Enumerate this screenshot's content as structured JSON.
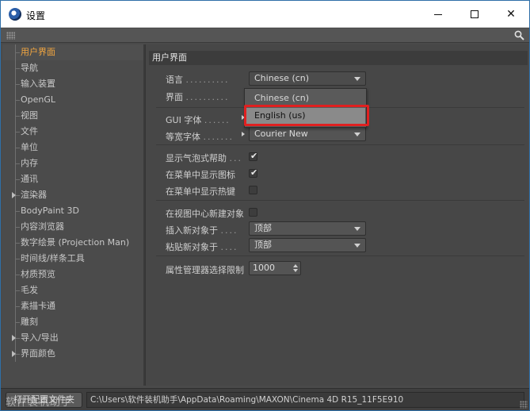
{
  "window": {
    "title": "设置"
  },
  "sidebar": {
    "items": [
      {
        "label": "用户界面",
        "active": true,
        "expandable": false
      },
      {
        "label": "导航",
        "active": false,
        "expandable": false
      },
      {
        "label": "输入装置",
        "active": false,
        "expandable": false
      },
      {
        "label": "OpenGL",
        "active": false,
        "expandable": false
      },
      {
        "label": "视图",
        "active": false,
        "expandable": false
      },
      {
        "label": "文件",
        "active": false,
        "expandable": false
      },
      {
        "label": "单位",
        "active": false,
        "expandable": false
      },
      {
        "label": "内存",
        "active": false,
        "expandable": false
      },
      {
        "label": "通讯",
        "active": false,
        "expandable": false
      },
      {
        "label": "渲染器",
        "active": false,
        "expandable": true
      },
      {
        "label": "BodyPaint 3D",
        "active": false,
        "expandable": false
      },
      {
        "label": "内容浏览器",
        "active": false,
        "expandable": false
      },
      {
        "label": "数字绘景 (Projection Man)",
        "active": false,
        "expandable": false
      },
      {
        "label": "时间线/样条工具",
        "active": false,
        "expandable": false
      },
      {
        "label": "材质预览",
        "active": false,
        "expandable": false
      },
      {
        "label": "毛发",
        "active": false,
        "expandable": false
      },
      {
        "label": "素描卡通",
        "active": false,
        "expandable": false
      },
      {
        "label": "雕刻",
        "active": false,
        "expandable": false
      },
      {
        "label": "导入/导出",
        "active": false,
        "expandable": true
      },
      {
        "label": "界面颜色",
        "active": false,
        "expandable": true
      }
    ],
    "accent_color": "#f2a640"
  },
  "content": {
    "section_title": "用户界面",
    "language": {
      "label": "语言",
      "dots": "..........",
      "value": "Chinese (cn)"
    },
    "interface": {
      "label": "界面",
      "dots": ".........."
    },
    "language_popup": {
      "options": [
        "Chinese (cn)",
        "English (us)"
      ],
      "highlighted": "English (us)",
      "highlight_box_color": "#e02020"
    },
    "gui_font": {
      "label": "GUI 字体",
      "dots": "......"
    },
    "mono_font": {
      "label": "等宽字体",
      "dots": ".......",
      "value": "Courier New"
    },
    "bubble_help": {
      "label": "显示气泡式帮助",
      "dots": "...",
      "checked": true
    },
    "menu_icons": {
      "label": "在菜单中显示图标",
      "checked": true
    },
    "menu_hotkeys": {
      "label": "在菜单中显示热键",
      "checked": false
    },
    "new_object_center": {
      "label": "在视图中心新建对象",
      "checked": false
    },
    "insert_new_object": {
      "label": "插入新对象于",
      "dots": "....",
      "value": "顶部"
    },
    "paste_new_object": {
      "label": "粘贴新对象于",
      "dots": "....",
      "value": "顶部"
    },
    "attribute_limit": {
      "label": "属性管理器选择限制",
      "value": "1000"
    }
  },
  "bottom": {
    "open_folder_label": "打开配置文件夹",
    "path": "C:\\Users\\软件装机助手\\AppData\\Roaming\\MAXON\\Cinema 4D R15_11F5E910",
    "watermark": "软件装机助手"
  }
}
